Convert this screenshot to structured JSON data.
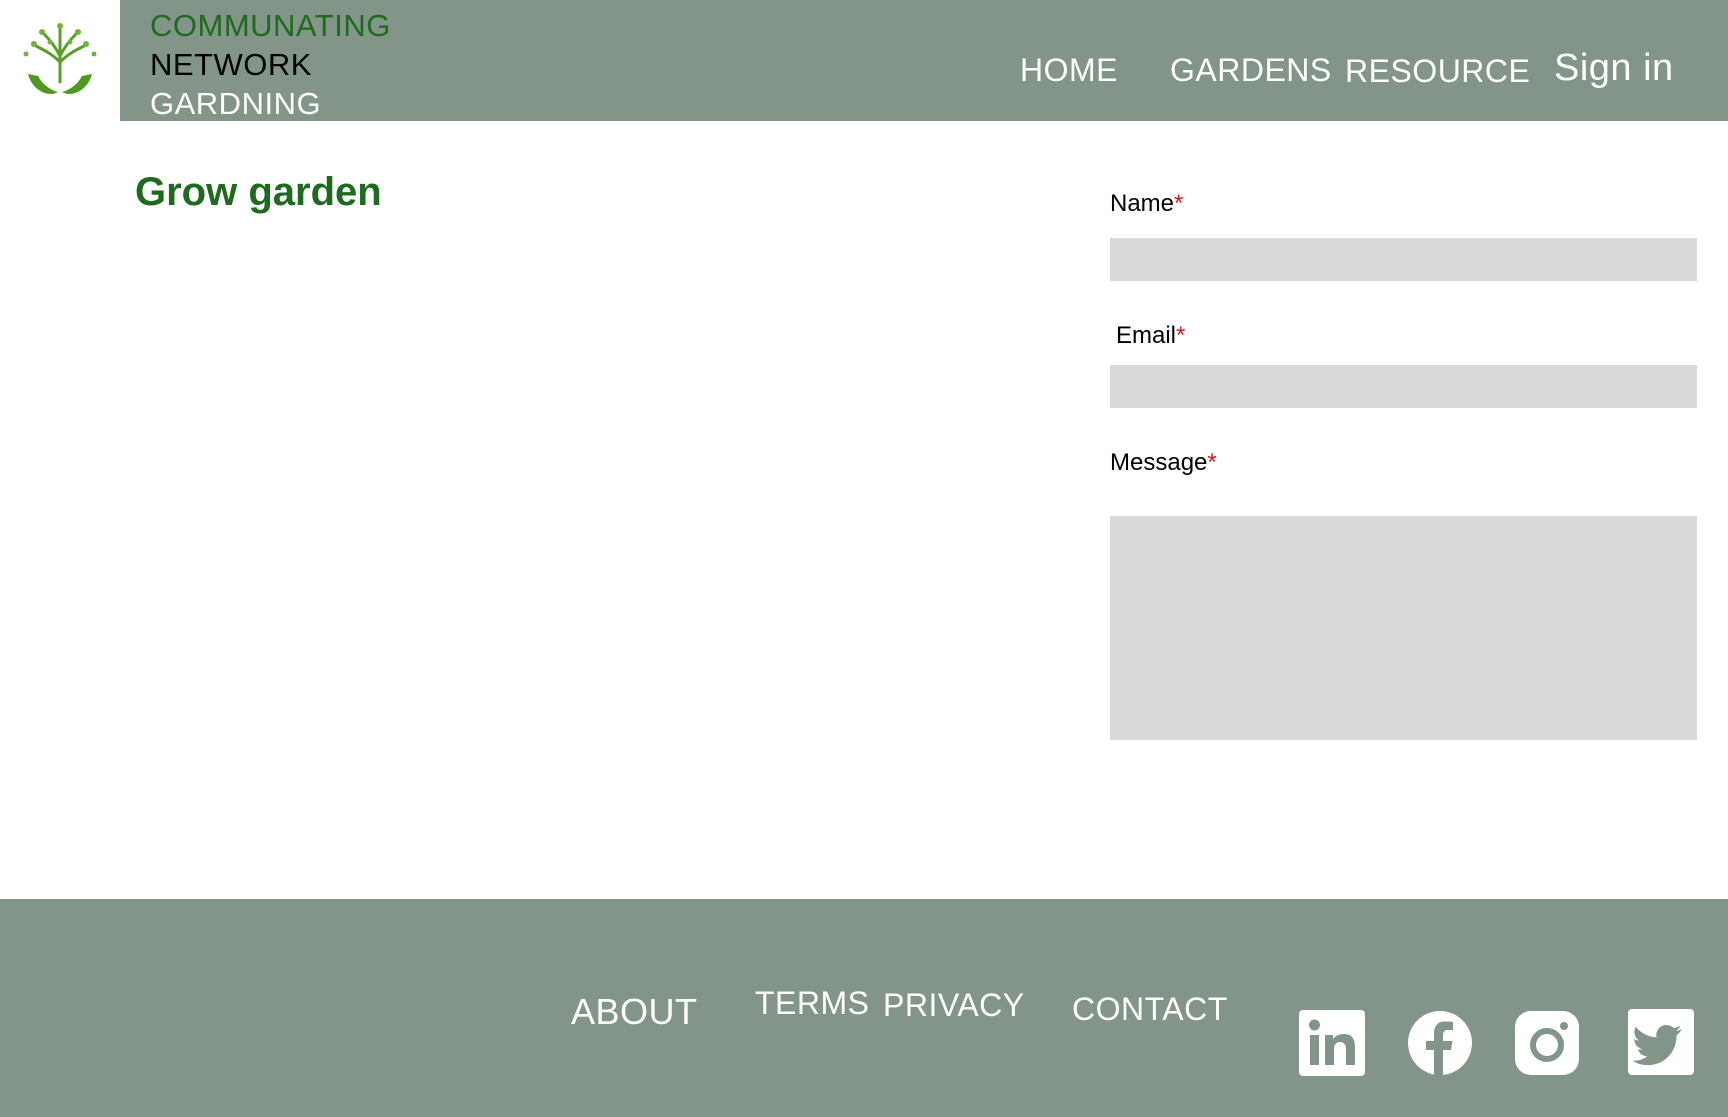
{
  "brand": {
    "line1": "COMMUNATING",
    "line2": "NETWORK",
    "line3": "GARDNING"
  },
  "nav": {
    "home": "HOME",
    "gardens": "GARDENS",
    "resource": "RESOURCE",
    "sign_in": "Sign in"
  },
  "page": {
    "title": "Grow garden"
  },
  "form": {
    "name_label": "Name",
    "email_label": "Email",
    "message_label": "Message",
    "required_mark": "*"
  },
  "footer": {
    "about": "ABOUT",
    "terms": "TERMS",
    "privacy": "PRIVACY",
    "contact": "CONTACT",
    "social_icons": [
      "linkedin-icon",
      "facebook-icon",
      "instagram-icon",
      "twitter-icon"
    ]
  },
  "colors": {
    "header_bg": "#829588",
    "brand_green": "#1e6b1f",
    "required_red": "#d0191f",
    "field_bg": "#d9d9d9"
  }
}
